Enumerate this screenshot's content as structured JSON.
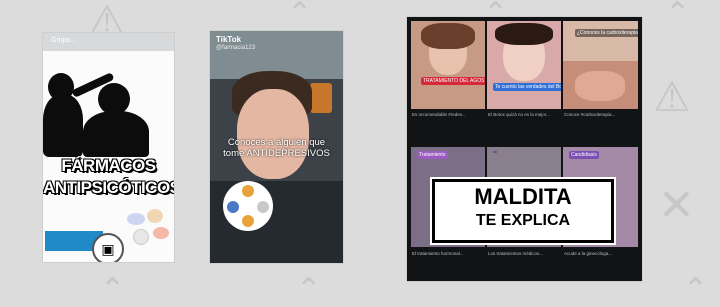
{
  "card1": {
    "brand": "Grupo...",
    "title_line1": "FÁRMACOS",
    "title_line2": "ANTIPSICÓTICOS"
  },
  "card2": {
    "brand": "TikTok",
    "username": "@farmacia123",
    "caption": "Conoces a alguien que tome ANTIDEPRESIVOS"
  },
  "card3": {
    "banner_line1": "MALDITA",
    "banner_line2": "TE EXPLICA",
    "tiles": [
      {
        "chip": "TRATAMIENTO DEL AGOSTO",
        "caption": "Es recomendable #redes..."
      },
      {
        "chip": "Te cuento las verdades del Botox",
        "caption": "El Botox quizá no es la mejor..."
      },
      {
        "chip": "¿Conoces la carboxiterapia?",
        "caption": "Conoce #carboxiterapia..."
      },
      {
        "chip": "Tratamiento",
        "caption": "El tratamiento hormonal..."
      },
      {
        "chip": "",
        "caption": "Los tratamientos médicos..."
      },
      {
        "chip": "Candidiasis",
        "caption": "Acude a la ginecóloga..."
      }
    ]
  },
  "colors": {
    "background": "#dcdcdc",
    "card3_bg": "#121315",
    "chip_red": "#d6283a",
    "chip_blue": "#2f6fd6"
  }
}
